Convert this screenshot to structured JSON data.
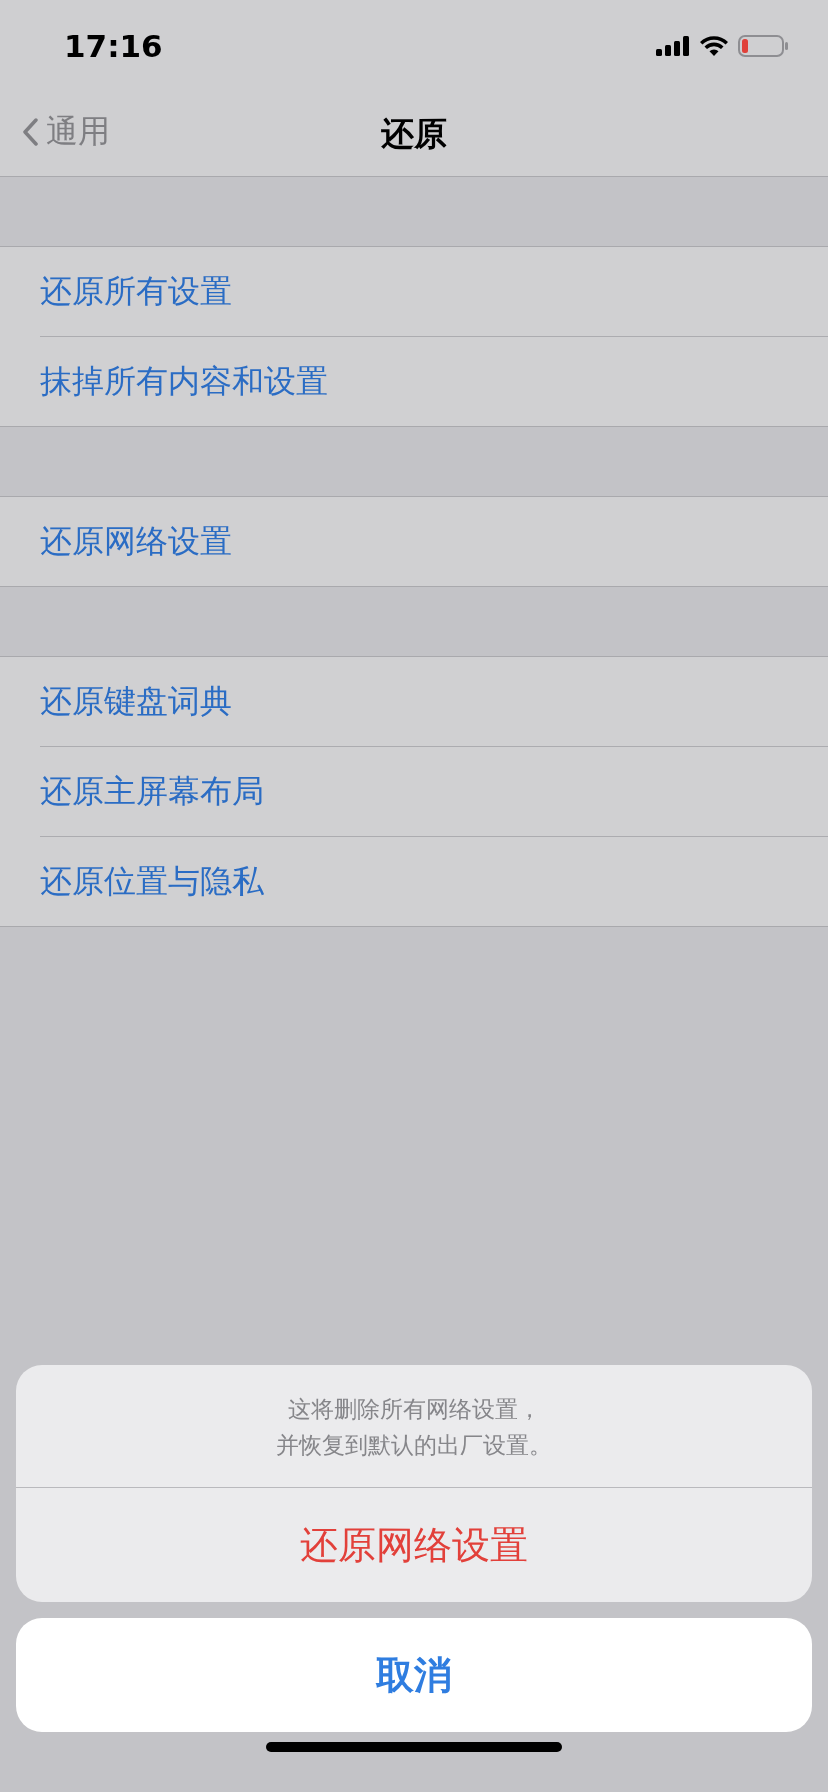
{
  "status_bar": {
    "time": "17:16"
  },
  "nav_bar": {
    "back_label": "通用",
    "title": "还原"
  },
  "groups": [
    {
      "items": [
        {
          "label": "还原所有设置"
        },
        {
          "label": "抹掉所有内容和设置"
        }
      ]
    },
    {
      "items": [
        {
          "label": "还原网络设置"
        }
      ]
    },
    {
      "items": [
        {
          "label": "还原键盘词典"
        },
        {
          "label": "还原主屏幕布局"
        },
        {
          "label": "还原位置与隐私"
        }
      ]
    }
  ],
  "action_sheet": {
    "message_lines": [
      "这将删除所有网络设置，",
      "并恢复到默认的出厂设置。"
    ],
    "destructive_button": "还原网络设置",
    "cancel_button": "取消"
  }
}
